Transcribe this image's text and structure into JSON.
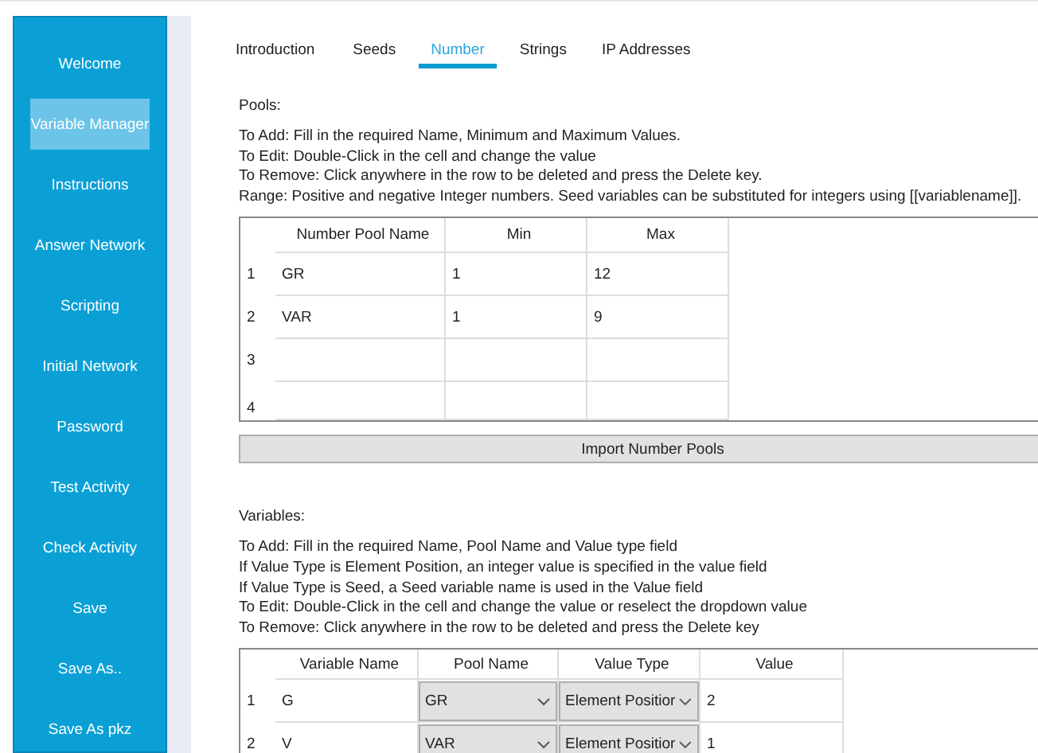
{
  "sidebar": {
    "items": [
      {
        "label": "Welcome",
        "selected": false
      },
      {
        "label": "Variable Manager",
        "selected": true
      },
      {
        "label": "Instructions",
        "selected": false
      },
      {
        "label": "Answer Network",
        "selected": false
      },
      {
        "label": "Scripting",
        "selected": false
      },
      {
        "label": "Initial Network",
        "selected": false
      },
      {
        "label": "Password",
        "selected": false
      },
      {
        "label": "Test Activity",
        "selected": false
      },
      {
        "label": "Check Activity",
        "selected": false
      },
      {
        "label": "Save",
        "selected": false
      },
      {
        "label": "Save As..",
        "selected": false
      },
      {
        "label": "Save As pkz",
        "selected": false
      }
    ]
  },
  "tabs": [
    {
      "label": "Introduction",
      "selected": false
    },
    {
      "label": "Seeds",
      "selected": false
    },
    {
      "label": "Number",
      "selected": true
    },
    {
      "label": "Strings",
      "selected": false
    },
    {
      "label": "IP Addresses",
      "selected": false
    }
  ],
  "pools": {
    "heading": "Pools:",
    "instructions": [
      "To Add: Fill in the required Name, Minimum and Maximum Values.",
      "To Edit: Double-Click in the cell and change the value",
      "To Remove: Click anywhere in the row to be deleted and press the Delete key.",
      "Range: Positive and negative Integer numbers. Seed variables can be substituted for integers using [[variablename]]."
    ],
    "table": {
      "columns": [
        "Number Pool Name",
        "Min",
        "Max"
      ],
      "rows": [
        {
          "index": "1",
          "cells": [
            "GR",
            "1",
            "12"
          ]
        },
        {
          "index": "2",
          "cells": [
            "VAR",
            "1",
            "9"
          ]
        },
        {
          "index": "3",
          "cells": []
        },
        {
          "index": "4",
          "cells": []
        }
      ]
    },
    "button": "Import Number Pools"
  },
  "variables": {
    "heading": "Variables:",
    "instructions": [
      "To Add: Fill in the required Name, Pool Name and Value type field",
      "If Value Type is Element Position, an integer value is specified in the value field",
      "If Value Type is Seed, a Seed variable name is used in the Value field",
      "To Edit: Double-Click in the cell and change the value or reselect the dropdown value",
      "To Remove: Click anywhere in the row to be deleted and press the Delete key"
    ],
    "table": {
      "columns": [
        "Variable Name",
        "Pool Name",
        "Value Type",
        "Value"
      ],
      "rows": [
        {
          "index": "1",
          "name": "G",
          "pool": "GR",
          "value_type": "Element Positior",
          "value": "2"
        },
        {
          "index": "2",
          "name": "V",
          "pool": "VAR",
          "value_type": "Element Positior",
          "value": "1"
        }
      ]
    }
  }
}
